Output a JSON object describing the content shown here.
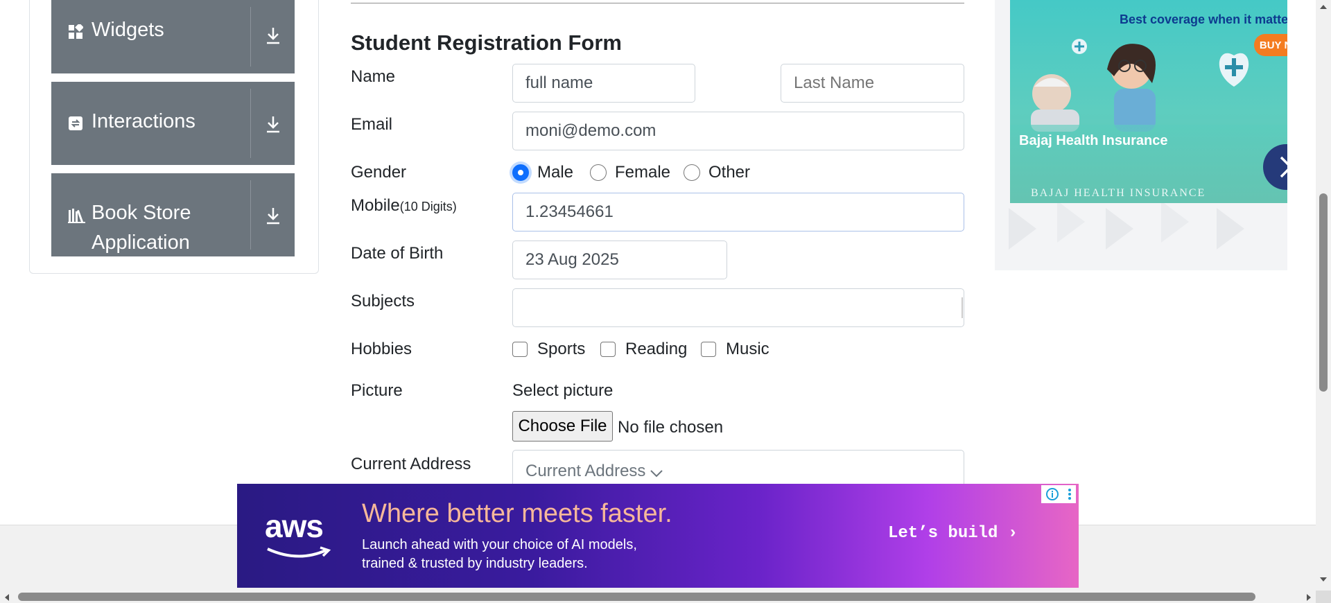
{
  "sidebar": {
    "groups": [
      {
        "label": "Widgets",
        "icon": "widgets-icon"
      },
      {
        "label": "Interactions",
        "icon": "interactions-icon"
      },
      {
        "label_line1": "Book Store",
        "label_line2": "Application",
        "icon": "books-icon"
      }
    ]
  },
  "form": {
    "title": "Student Registration Form",
    "name_label": "Name",
    "first_name_value": "full name",
    "last_name_placeholder": "Last Name",
    "email_label": "Email",
    "email_value": "moni@demo.com",
    "gender_label": "Gender",
    "gender_options": [
      "Male",
      "Female",
      "Other"
    ],
    "gender_selected": "Male",
    "mobile_label": "Mobile",
    "mobile_hint": "(10 Digits)",
    "mobile_value": "1.23454661",
    "dob_label": "Date of Birth",
    "dob_value": "23 Aug 2025",
    "subjects_label": "Subjects",
    "subjects_value": "",
    "hobbies_label": "Hobbies",
    "hobbies": [
      "Sports",
      "Reading",
      "Music"
    ],
    "picture_label": "Picture",
    "select_picture": "Select picture",
    "choose_file": "Choose File",
    "no_file": "No file chosen",
    "current_address_label": "Current Address",
    "current_address_placeholder": "Current Address"
  },
  "right_ad": {
    "headline": "Best coverage when it matters mos",
    "cta": "BUY NOW",
    "brand": "Bajaj Health Insurance",
    "brand_caps": "BAJAJ HEALTH INSURANCE"
  },
  "bottom_ad": {
    "logo": "aws",
    "headline": "Where better meets faster.",
    "line1": "Launch ahead with your choice of AI models,",
    "line2": "trained & trusted by industry leaders.",
    "cta": "Let’s build ›"
  },
  "colors": {
    "sidebar_group_bg": "#6c757d",
    "radio_selected": "#0d6efd",
    "right_ad_bg": "#45c9c6",
    "right_ad_cta": "#f47c20",
    "bottom_ad_start": "#2a1a83",
    "bottom_ad_end": "#e766c5"
  }
}
